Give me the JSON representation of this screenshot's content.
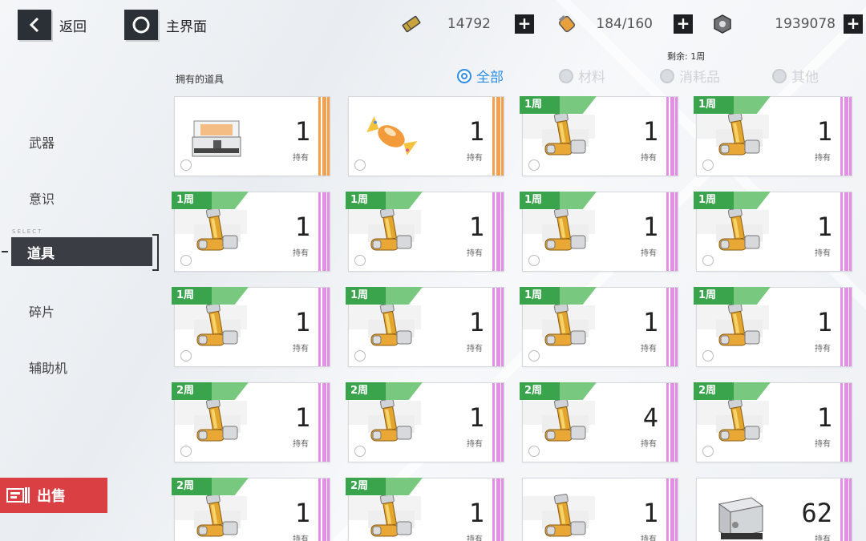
{
  "topbar": {
    "back_label": "返回",
    "main_label": "主界面",
    "resources": [
      {
        "icon": "ticket-icon",
        "value": "14792"
      },
      {
        "icon": "stamina-icon",
        "value": "184/160"
      },
      {
        "icon": "coin-icon",
        "value": "1939078"
      }
    ],
    "plus_label": "+"
  },
  "remain_text": "剩余: 1周",
  "left_menu": {
    "select_tag": "SELECT",
    "items": [
      "武器",
      "意识",
      "道具",
      "碎片",
      "辅助机"
    ],
    "selected": "道具"
  },
  "sell_label": "出售",
  "owned_label": "拥有的道具",
  "filters": [
    "全部",
    "材料",
    "消耗品",
    "其他"
  ],
  "active_filter": "全部",
  "own_text": "持有",
  "items": [
    {
      "tag": "",
      "count": "1",
      "stripe": "orange",
      "icon": "chest-icon"
    },
    {
      "tag": "",
      "count": "1",
      "stripe": "orange",
      "icon": "candy-icon"
    },
    {
      "tag": "1周",
      "count": "1",
      "stripe": "pink",
      "icon": "core-icon"
    },
    {
      "tag": "1周",
      "count": "1",
      "stripe": "pink",
      "icon": "core-icon"
    },
    {
      "tag": "1周",
      "count": "1",
      "stripe": "pink",
      "icon": "core-icon"
    },
    {
      "tag": "1周",
      "count": "1",
      "stripe": "pink",
      "icon": "core-icon"
    },
    {
      "tag": "1周",
      "count": "1",
      "stripe": "pink",
      "icon": "core-icon"
    },
    {
      "tag": "1周",
      "count": "1",
      "stripe": "pink",
      "icon": "core-icon"
    },
    {
      "tag": "1周",
      "count": "1",
      "stripe": "pink",
      "icon": "core-icon"
    },
    {
      "tag": "1周",
      "count": "1",
      "stripe": "pink",
      "icon": "core-icon"
    },
    {
      "tag": "1周",
      "count": "1",
      "stripe": "pink",
      "icon": "core-icon"
    },
    {
      "tag": "1周",
      "count": "1",
      "stripe": "pink",
      "icon": "core-icon"
    },
    {
      "tag": "2周",
      "count": "1",
      "stripe": "pink",
      "icon": "core-icon"
    },
    {
      "tag": "2周",
      "count": "1",
      "stripe": "pink",
      "icon": "core-icon"
    },
    {
      "tag": "2周",
      "count": "4",
      "stripe": "pink",
      "icon": "core-icon"
    },
    {
      "tag": "2周",
      "count": "1",
      "stripe": "pink",
      "icon": "core-icon"
    },
    {
      "tag": "2周",
      "count": "1",
      "stripe": "pink",
      "icon": "core-icon"
    },
    {
      "tag": "2周",
      "count": "1",
      "stripe": "pink",
      "icon": "core-icon"
    },
    {
      "tag": "",
      "count": "1",
      "stripe": "pink",
      "icon": "core-icon"
    },
    {
      "tag": "",
      "count": "62",
      "stripe": "pink",
      "icon": "box-icon"
    }
  ],
  "colors": {
    "accent": "#2e8ee8",
    "sell": "#d93f43",
    "tag_green": "#3aa44c",
    "stripe_orange": "#f4a04e",
    "stripe_pink": "#e58ee6"
  }
}
